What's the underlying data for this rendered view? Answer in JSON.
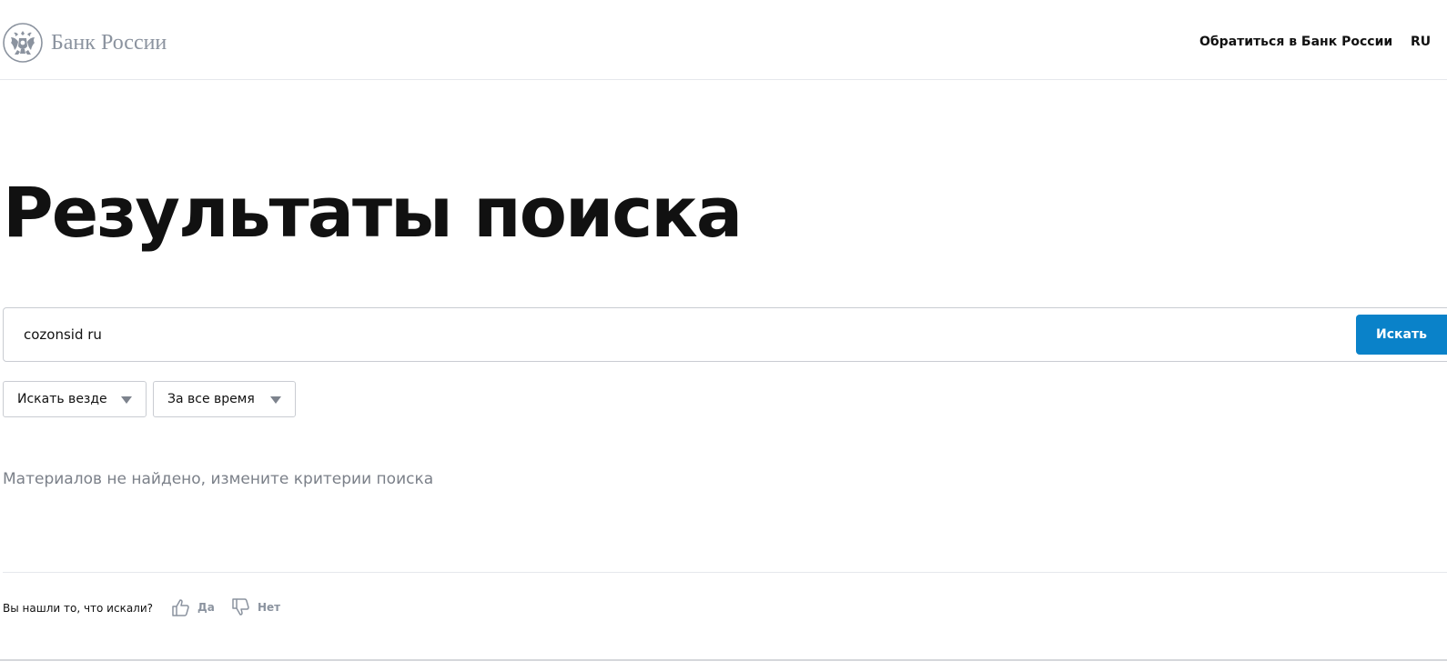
{
  "header": {
    "logo_text": "Банк России",
    "nav_contact": "Обратиться в Банк России",
    "nav_language": "RU"
  },
  "main": {
    "title": "Результаты поиска",
    "search": {
      "value": "cozonsid ru",
      "button_label": "Искать"
    },
    "filters": {
      "scope": "Искать везде",
      "period": "За все время"
    },
    "empty_message": "Материалов не найдено, измените критерии поиска"
  },
  "feedback": {
    "question": "Вы нашли то, что искали?",
    "yes_label": "Да",
    "no_label": "Нет"
  },
  "colors": {
    "accent": "#0a82c9",
    "muted_text": "#7b8089",
    "logo_gray": "#8b939f"
  },
  "icons": {
    "logo": "double-headed-eagle-emblem",
    "dropdown": "triangle-down",
    "yes": "thumbs-up",
    "no": "thumbs-down"
  }
}
